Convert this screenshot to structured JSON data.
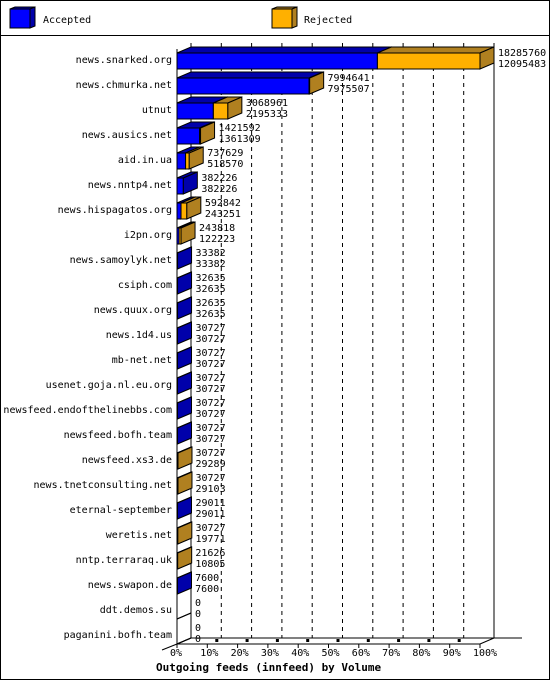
{
  "legend": {
    "accepted_label": "Accepted",
    "rejected_label": "Rejected"
  },
  "colors": {
    "accepted": "#0000ff",
    "accepted_dark": "#0000aa",
    "rejected": "#ffb000",
    "rejected_dark": "#b08020"
  },
  "chart_data": {
    "type": "bar",
    "orientation": "horizontal",
    "stacked": true,
    "title": "Outgoing feeds (innfeed) by Volume",
    "xlabel": "Outgoing feeds (innfeed) by Volume",
    "ylabel": "",
    "xlim": [
      0,
      100
    ],
    "x_unit": "% of max offered volume",
    "x_ticks": [
      "0%",
      "10%",
      "20%",
      "30%",
      "40%",
      "50%",
      "60%",
      "70%",
      "80%",
      "90%",
      "100%"
    ],
    "grid": true,
    "legend_position": "top",
    "categories": [
      "news.snarked.org",
      "news.chmurka.net",
      "utnut",
      "news.ausics.net",
      "aid.in.ua",
      "news.nntp4.net",
      "news.hispagatos.org",
      "i2pn.org",
      "news.samoylyk.net",
      "csiph.com",
      "news.quux.org",
      "news.1d4.us",
      "mb-net.net",
      "usenet.goja.nl.eu.org",
      "newsfeed.endofthelinebbs.com",
      "newsfeed.bofh.team",
      "newsfeed.xs3.de",
      "news.tnetconsulting.net",
      "eternal-september",
      "weretis.net",
      "nntp.terraraq.uk",
      "news.swapon.de",
      "ddt.demos.su",
      "paganini.bofh.team"
    ],
    "offered": [
      18285760,
      7994641,
      3068961,
      1421592,
      737629,
      382226,
      592842,
      243818,
      33382,
      32635,
      32635,
      30727,
      30727,
      30727,
      30727,
      30727,
      30727,
      30727,
      29011,
      30727,
      21626,
      7600,
      0,
      0
    ],
    "series": [
      {
        "name": "Accepted",
        "values": [
          12095483,
          7975507,
          2195333,
          1361309,
          518570,
          382226,
          243251,
          122223,
          33382,
          32635,
          32635,
          30727,
          30727,
          30727,
          30727,
          30727,
          29289,
          29103,
          29011,
          19771,
          10805,
          7600,
          0,
          0
        ]
      },
      {
        "name": "Rejected",
        "values": [
          6190277,
          19134,
          873628,
          60283,
          219059,
          0,
          349591,
          121595,
          0,
          0,
          0,
          0,
          0,
          0,
          0,
          0,
          1438,
          1624,
          0,
          10956,
          10821,
          0,
          0,
          0
        ]
      }
    ]
  }
}
